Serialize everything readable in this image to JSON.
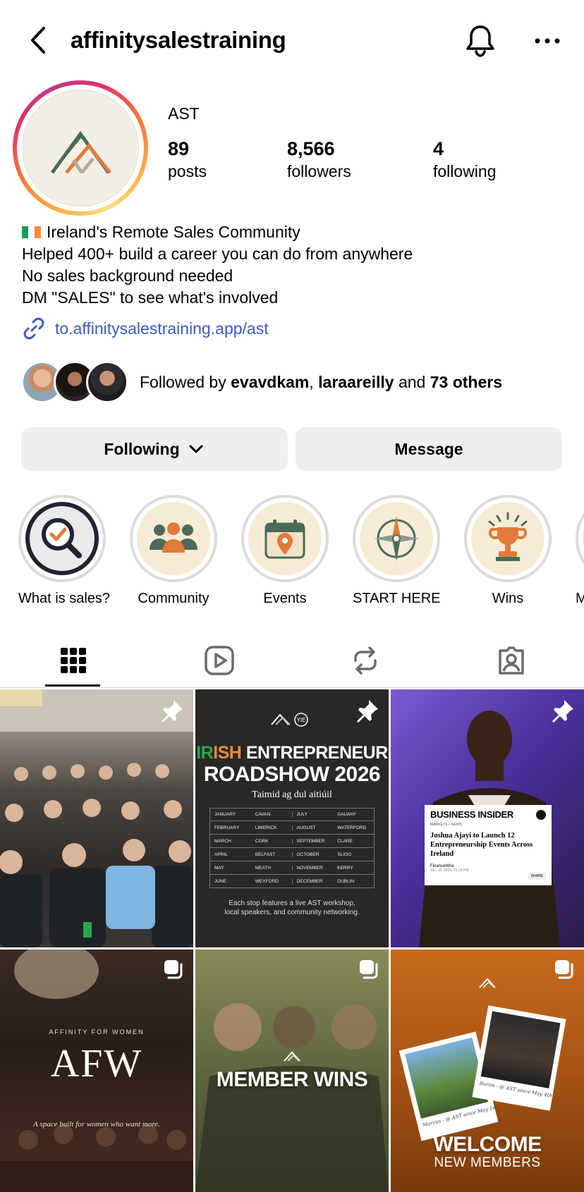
{
  "header": {
    "username": "affinitysalestraining"
  },
  "profile": {
    "display_name": "AST",
    "stats": {
      "posts": {
        "count": "89",
        "label": "posts"
      },
      "followers": {
        "count": "8,566",
        "label": "followers"
      },
      "following": {
        "count": "4",
        "label": "following"
      }
    },
    "bio": [
      "Ireland's Remote Sales Community",
      "Helped 400+ build a career you can do from anywhere",
      "No sales background needed",
      "DM \"SALES\" to see what's involved"
    ],
    "link": "to.affinitysalestraining.app/ast",
    "followed_by": {
      "prefix": "Followed by ",
      "user1": "evavdkam",
      "sep": ", ",
      "user2": "laraareilly",
      "and": " and ",
      "others": "73 others"
    }
  },
  "actions": {
    "following_label": "Following",
    "message_label": "Message"
  },
  "highlights": [
    {
      "label": "What is sales?",
      "icon": "magnifier-check-icon"
    },
    {
      "label": "Community",
      "icon": "people-group-icon"
    },
    {
      "label": "Events",
      "icon": "calendar-pin-icon"
    },
    {
      "label": "START HERE",
      "icon": "compass-icon"
    },
    {
      "label": "Wins",
      "icon": "trophy-icon"
    },
    {
      "label": "M"
    }
  ],
  "tabs": [
    "grid-icon",
    "reels-icon",
    "reposts-icon",
    "tagged-icon"
  ],
  "posts": {
    "roadshow": {
      "title_green": "IR",
      "title_orange": "ISH",
      "title_rest": " ENTREPRENEUR",
      "title_line2": "ROADSHOW 2026",
      "subtitle": "Taimid ag dul aitiúil",
      "schedule": [
        [
          "JANUARY",
          "CAVAN",
          "JULY",
          "GALWAY"
        ],
        [
          "FEBRUARY",
          "LIMERICK",
          "AUGUST",
          "WATERFORD"
        ],
        [
          "MARCH",
          "CORK",
          "SEPTEMBER",
          "CLARE"
        ],
        [
          "APRIL",
          "BELFAST",
          "OCTOBER",
          "SLIGO"
        ],
        [
          "MAY",
          "MEATH",
          "NOVEMBER",
          "KERRY"
        ],
        [
          "JUNE",
          "WEXFORD",
          "DECEMBER",
          "DUBLIN"
        ]
      ],
      "footer1": "Each stop features a live AST workshop,",
      "footer2": "local speakers, and community networking."
    },
    "insider": {
      "brand": "BUSINESS INSIDER",
      "section": "MARKETS > NEWS",
      "headline": "Joshua Ajayi to Launch 12 Entrepreneurship Events Across Ireland",
      "source": "FinanceWire",
      "date": "Jan. 15, 2026, 01:24 PM",
      "share": "SHARE"
    },
    "afw": {
      "kicker": "AFFINITY FOR WOMEN",
      "title": "AFW",
      "tagline": "A space built for women who want more."
    },
    "wins": {
      "title": "MEMBER WINS"
    },
    "welcome": {
      "caption1": "Marcus - @ AST since May 1st",
      "caption2": "Burim - @ AST since May 4th",
      "title": "WELCOME",
      "subtitle": "NEW MEMBERS"
    }
  },
  "colors": {
    "link": "#3d5ac8",
    "button_bg": "#efefef",
    "highlight_bg": "#f7ebd5",
    "accent_orange": "#e07b39",
    "accent_green": "#4a6b5a"
  }
}
